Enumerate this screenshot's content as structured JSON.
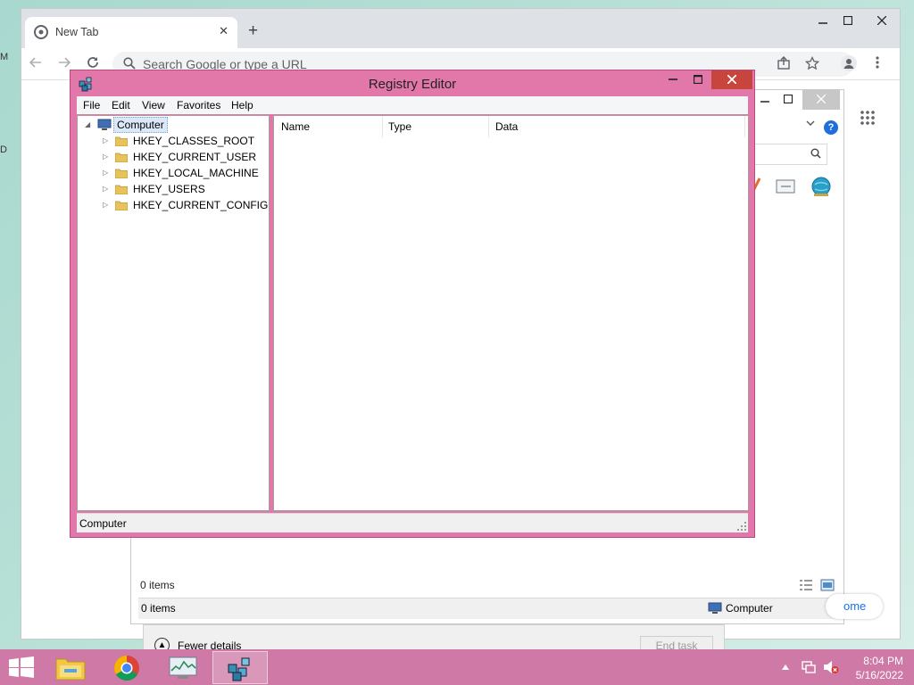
{
  "desktop_edge": {
    "top": "M",
    "mid": "D"
  },
  "chrome": {
    "tab_title": "New Tab",
    "tab_close": "✕",
    "new_tab": "+",
    "omnibox_placeholder": "Search Google or type a URL",
    "relaunch_label": "ome"
  },
  "explorer": {
    "status_items": "0 items"
  },
  "task_manager": {
    "status_items": "0 items",
    "status_location": "Computer",
    "fewer_details": "Fewer details",
    "end_task": "End task"
  },
  "regedit": {
    "title": "Registry Editor",
    "menu": [
      {
        "label": "File"
      },
      {
        "label": "Edit"
      },
      {
        "label": "View"
      },
      {
        "label": "Favorites"
      },
      {
        "label": "Help"
      }
    ],
    "tree_root": "Computer",
    "hives": [
      {
        "label": "HKEY_CLASSES_ROOT"
      },
      {
        "label": "HKEY_CURRENT_USER"
      },
      {
        "label": "HKEY_LOCAL_MACHINE"
      },
      {
        "label": "HKEY_USERS"
      },
      {
        "label": "HKEY_CURRENT_CONFIG"
      }
    ],
    "columns": [
      {
        "label": "Name"
      },
      {
        "label": "Type"
      },
      {
        "label": "Data"
      }
    ],
    "status": "Computer"
  },
  "taskbar": {
    "time": "8:04 PM",
    "date": "5/16/2022"
  },
  "colors": {
    "taskbar": "#cf7aa6",
    "regedit_frame": "#e278aa",
    "close_button": "#c7453c"
  }
}
